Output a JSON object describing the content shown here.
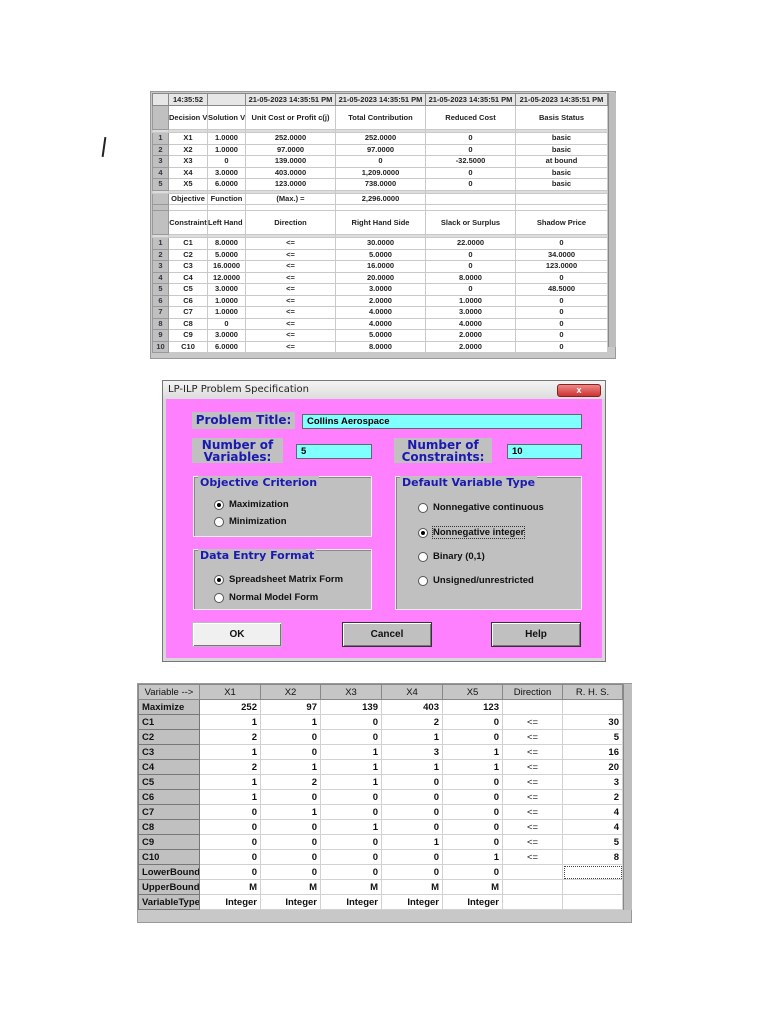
{
  "results": {
    "timestamp_row": [
      "14:35:52",
      "",
      "21-05-2023 14:35:51 PM",
      "21-05-2023 14:35:51 PM",
      "21-05-2023 14:35:51 PM",
      "21-05-2023 14:35:51 PM"
    ],
    "var_headers": [
      "Decision Variable",
      "Solution Value",
      "Unit Cost or Profit c(j)",
      "Total Contribution",
      "Reduced Cost",
      "Basis Status"
    ],
    "var_rows": [
      [
        "1",
        "X1",
        "1.0000",
        "252.0000",
        "252.0000",
        "0",
        "basic"
      ],
      [
        "2",
        "X2",
        "1.0000",
        "97.0000",
        "97.0000",
        "0",
        "basic"
      ],
      [
        "3",
        "X3",
        "0",
        "139.0000",
        "0",
        "-32.5000",
        "at bound"
      ],
      [
        "4",
        "X4",
        "3.0000",
        "403.0000",
        "1,209.0000",
        "0",
        "basic"
      ],
      [
        "5",
        "X5",
        "6.0000",
        "123.0000",
        "738.0000",
        "0",
        "basic"
      ]
    ],
    "objective_row": [
      "Objective",
      "Function",
      "(Max.) =",
      "2,296.0000",
      "",
      ""
    ],
    "con_headers": [
      "Constraint",
      "Left Hand Side",
      "Direction",
      "Right Hand Side",
      "Slack or Surplus",
      "Shadow Price"
    ],
    "con_rows": [
      [
        "1",
        "C1",
        "8.0000",
        "<=",
        "30.0000",
        "22.0000",
        "0"
      ],
      [
        "2",
        "C2",
        "5.0000",
        "<=",
        "5.0000",
        "0",
        "34.0000"
      ],
      [
        "3",
        "C3",
        "16.0000",
        "<=",
        "16.0000",
        "0",
        "123.0000"
      ],
      [
        "4",
        "C4",
        "12.0000",
        "<=",
        "20.0000",
        "8.0000",
        "0"
      ],
      [
        "5",
        "C5",
        "3.0000",
        "<=",
        "3.0000",
        "0",
        "48.5000"
      ],
      [
        "6",
        "C6",
        "1.0000",
        "<=",
        "2.0000",
        "1.0000",
        "0"
      ],
      [
        "7",
        "C7",
        "1.0000",
        "<=",
        "4.0000",
        "3.0000",
        "0"
      ],
      [
        "8",
        "C8",
        "0",
        "<=",
        "4.0000",
        "4.0000",
        "0"
      ],
      [
        "9",
        "C9",
        "3.0000",
        "<=",
        "5.0000",
        "2.0000",
        "0"
      ],
      [
        "10",
        "C10",
        "6.0000",
        "<=",
        "8.0000",
        "2.0000",
        "0"
      ]
    ]
  },
  "dialog": {
    "title": "LP-ILP Problem Specification",
    "close_label": "x",
    "problem_title_label": "Problem Title:",
    "problem_title_value": "Collins Aerospace",
    "num_variables_label": "Number of Variables:",
    "num_variables_value": "5",
    "num_constraints_label": "Number of Constraints:",
    "num_constraints_value": "10",
    "objective_group": "Objective Criterion",
    "objective_options": [
      "Maximization",
      "Minimization"
    ],
    "objective_selected": 0,
    "entry_group": "Data Entry Format",
    "entry_options": [
      "Spreadsheet Matrix Form",
      "Normal Model Form"
    ],
    "entry_selected": 0,
    "vartype_group": "Default Variable Type",
    "vartype_options": [
      "Nonnegative continuous",
      "Nonnegative integer",
      "Binary (0,1)",
      "Unsigned/unrestricted"
    ],
    "vartype_selected": 1,
    "buttons": {
      "ok": "OK",
      "cancel": "Cancel",
      "help": "Help"
    }
  },
  "spreadsheet": {
    "headers": [
      "Variable -->",
      "X1",
      "X2",
      "X3",
      "X4",
      "X5",
      "Direction",
      "R. H. S."
    ],
    "rows": [
      [
        "Maximize",
        "252",
        "97",
        "139",
        "403",
        "123",
        "",
        ""
      ],
      [
        "C1",
        "1",
        "1",
        "0",
        "2",
        "0",
        "<=",
        "30"
      ],
      [
        "C2",
        "2",
        "0",
        "0",
        "1",
        "0",
        "<=",
        "5"
      ],
      [
        "C3",
        "1",
        "0",
        "1",
        "3",
        "1",
        "<=",
        "16"
      ],
      [
        "C4",
        "2",
        "1",
        "1",
        "1",
        "1",
        "<=",
        "20"
      ],
      [
        "C5",
        "1",
        "2",
        "1",
        "0",
        "0",
        "<=",
        "3"
      ],
      [
        "C6",
        "1",
        "0",
        "0",
        "0",
        "0",
        "<=",
        "2"
      ],
      [
        "C7",
        "0",
        "1",
        "0",
        "0",
        "0",
        "<=",
        "4"
      ],
      [
        "C8",
        "0",
        "0",
        "1",
        "0",
        "0",
        "<=",
        "4"
      ],
      [
        "C9",
        "0",
        "0",
        "0",
        "1",
        "0",
        "<=",
        "5"
      ],
      [
        "C10",
        "0",
        "0",
        "0",
        "0",
        "1",
        "<=",
        "8"
      ],
      [
        "LowerBound",
        "0",
        "0",
        "0",
        "0",
        "0",
        "",
        ""
      ],
      [
        "UpperBound",
        "M",
        "M",
        "M",
        "M",
        "M",
        "",
        ""
      ],
      [
        "VariableType",
        "Integer",
        "Integer",
        "Integer",
        "Integer",
        "Integer",
        "",
        ""
      ]
    ]
  }
}
